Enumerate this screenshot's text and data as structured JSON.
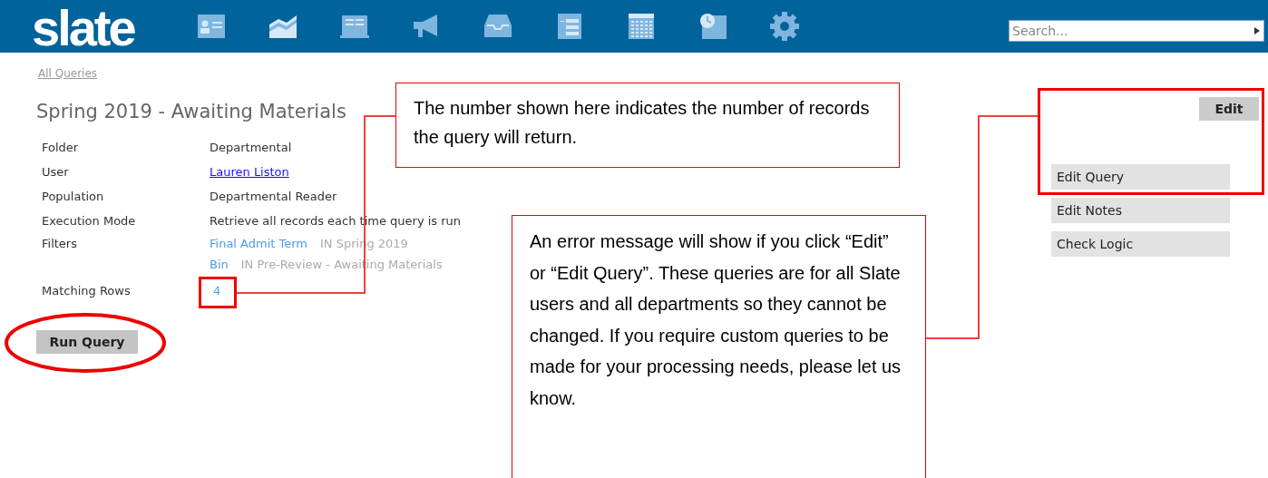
{
  "header": {
    "logo": "slate",
    "search": {
      "placeholder": "Search..."
    }
  },
  "breadcrumb": "All Queries",
  "title": "Spring 2019 - Awaiting Materials",
  "details": [
    {
      "label": "Folder",
      "kind": "text",
      "value": "Departmental"
    },
    {
      "label": "User",
      "kind": "link",
      "value": "Lauren Liston"
    },
    {
      "label": "Population",
      "kind": "text",
      "value": "Departmental Reader"
    },
    {
      "label": "Execution Mode",
      "kind": "text",
      "value": "Retrieve all records each time query is run"
    },
    {
      "label": "Filters",
      "kind": "filters",
      "filters": [
        {
          "field": "Final Admit Term",
          "condition": "IN Spring 2019"
        },
        {
          "field": "Bin",
          "condition": "IN Pre-Review - Awaiting Materials"
        }
      ]
    },
    {
      "label": "Matching Rows",
      "kind": "count",
      "value": "4"
    }
  ],
  "run_button": "Run Query",
  "actions": {
    "edit_button": "Edit",
    "items": [
      "Edit Query",
      "Edit Notes",
      "Check Logic"
    ]
  },
  "annotations": [
    {
      "text": "The number shown here indicates the number of records the query will return."
    },
    {
      "text": "An error message will show if you click “Edit” or “Edit Query”. These queries are for all Slate users and all departments so they cannot be changed.  If you require custom queries to be made for your processing needs, please let us know."
    }
  ]
}
